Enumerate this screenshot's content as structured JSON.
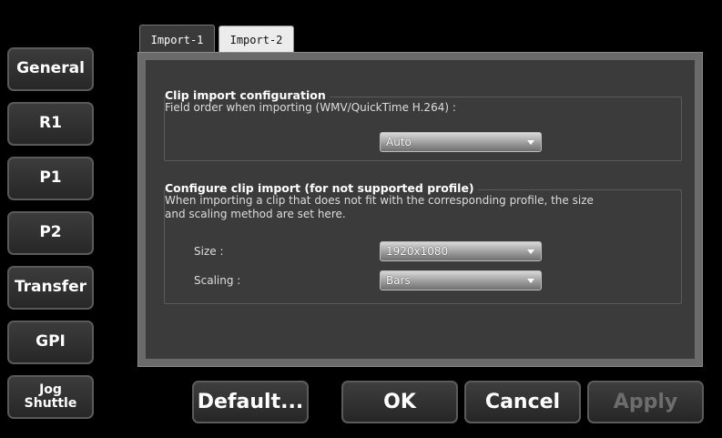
{
  "sidebar": {
    "items": [
      {
        "label": "General"
      },
      {
        "label": "R1"
      },
      {
        "label": "P1"
      },
      {
        "label": "P2"
      },
      {
        "label": "Transfer"
      },
      {
        "label": "GPI"
      },
      {
        "label_line1": "Jog",
        "label_line2": "Shuttle"
      }
    ]
  },
  "tabs": [
    {
      "label": "Import-1",
      "active": true
    },
    {
      "label": "Import-2",
      "active": false
    }
  ],
  "clip_import": {
    "title": "Clip import configuration",
    "description": "Field order when importing (WMV/QuickTime H.264) :",
    "field_order_value": "Auto"
  },
  "unsupported_import": {
    "title": "Configure clip import (for not supported profile)",
    "description_line1": "When importing a clip that does not fit with the corresponding profile, the size",
    "description_line2": "and scaling method are set here.",
    "size_label": "Size :",
    "size_value": "1920x1080",
    "scaling_label": "Scaling :",
    "scaling_value": "Bars"
  },
  "actions": {
    "default_label": "Default...",
    "ok_label": "OK",
    "cancel_label": "Cancel",
    "apply_label": "Apply",
    "apply_enabled": false
  },
  "icons": {
    "dropdown": "chevron-down-icon"
  }
}
